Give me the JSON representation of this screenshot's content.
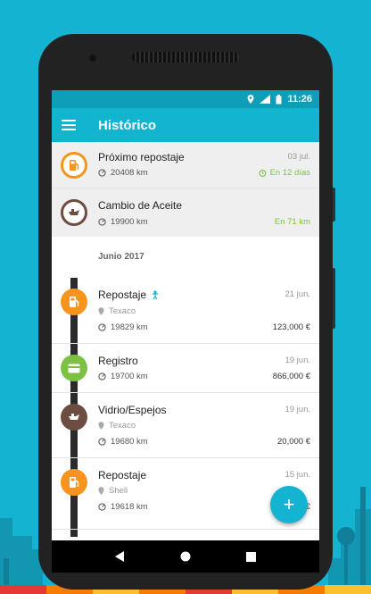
{
  "status_bar": {
    "time": "11:26",
    "network": "LTE"
  },
  "app_bar": {
    "title": "Histórico",
    "menu_icon": "hamburger-menu-icon"
  },
  "colors": {
    "accent": "#13b4d0",
    "fuel": "#f7941d",
    "registro": "#7cc142",
    "service": "#6d4c41",
    "positive": "#7cc142"
  },
  "upcoming": [
    {
      "title": "Próximo repostaje",
      "date": "03 jul.",
      "odometer": "20408 km",
      "remaining": "En 12 días",
      "icon": "fuel-pump-icon"
    },
    {
      "title": "Cambio de Aceite",
      "date": "",
      "odometer": "19900 km",
      "remaining": "En 71 km",
      "icon": "oil-can-icon"
    }
  ],
  "section": {
    "label": "Junio 2017"
  },
  "history": [
    {
      "title": "Repostaje",
      "date": "21 jun.",
      "station": "Texaco",
      "odometer": "19829 km",
      "amount": "123,000 €",
      "icon": "fuel-pump-icon"
    },
    {
      "title": "Registro",
      "date": "19 jun.",
      "station": "",
      "odometer": "19700 km",
      "amount": "866,000 €",
      "icon": "card-icon"
    },
    {
      "title": "Vidrio/Espejos",
      "date": "19 jun.",
      "station": "Texaco",
      "odometer": "19680 km",
      "amount": "20,000 €",
      "icon": "oil-can-icon"
    },
    {
      "title": "Repostaje",
      "date": "15 jun.",
      "station": "Shell",
      "odometer": "19618 km",
      "amount": "€",
      "icon": "fuel-pump-icon"
    }
  ],
  "fab": {
    "label": "+"
  }
}
